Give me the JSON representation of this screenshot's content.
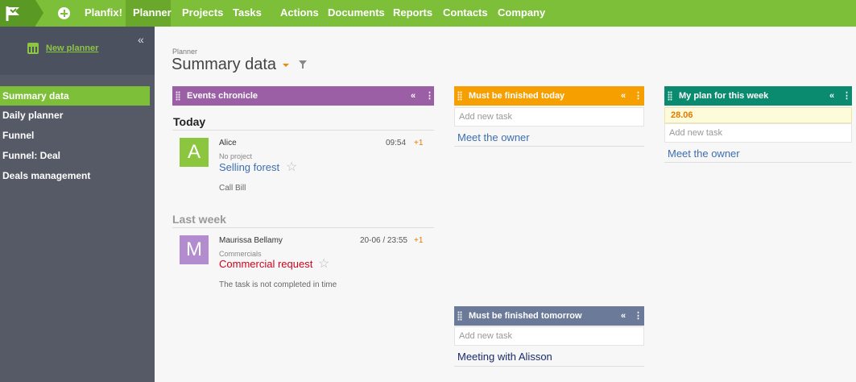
{
  "nav": {
    "brand": "Planfix!",
    "items": [
      "Planner",
      "Projects",
      "Tasks",
      "Actions",
      "Documents",
      "Reports",
      "Contacts",
      "Company"
    ],
    "active": "Planner"
  },
  "sidebar": {
    "new_planner": "New planner",
    "collapse": "«",
    "items": [
      "Summary data",
      "Daily planner",
      "Funnel",
      "Funnel: Deal",
      "Deals management"
    ],
    "active": "Summary data"
  },
  "header": {
    "breadcrumb": "Planner",
    "title": "Summary data"
  },
  "events": {
    "title": "Events chronicle",
    "color": "#9b5fa5",
    "sections": [
      {
        "heading": "Today",
        "items": [
          {
            "initial": "A",
            "avatar_color": "#8cc63f",
            "author": "Alice",
            "time": "09:54",
            "plus": "+1",
            "project": "No project",
            "task": "Selling forest",
            "task_color": "#3d6fb0",
            "note": "Call Bill"
          }
        ]
      },
      {
        "heading": "Last week",
        "items": [
          {
            "initial": "M",
            "avatar_color": "#b38cd0",
            "author": "Maurissa Bellamy",
            "time": "20-06 / 23:55",
            "plus": "+1",
            "project": "Commercials",
            "task": "Commercial request",
            "task_color": "#d0021b",
            "note": "The task is not completed in time"
          }
        ]
      }
    ]
  },
  "today": {
    "title": "Must be finished today",
    "color": "#f5a000",
    "add_placeholder": "Add new task",
    "tasks": [
      "Meet the owner"
    ]
  },
  "tomorrow": {
    "title": "Must be finished tomorrow",
    "color": "#6b7a99",
    "add_placeholder": "Add new task",
    "tasks": [
      "Meeting with Alisson"
    ]
  },
  "week": {
    "title": "My plan for this week",
    "color": "#0a8a6e",
    "date": "28.06",
    "add_placeholder": "Add new task",
    "tasks": [
      "Meet the owner"
    ]
  },
  "icons": {
    "panel_collapse": "«",
    "panel_menu": "⋮",
    "star": "☆"
  }
}
